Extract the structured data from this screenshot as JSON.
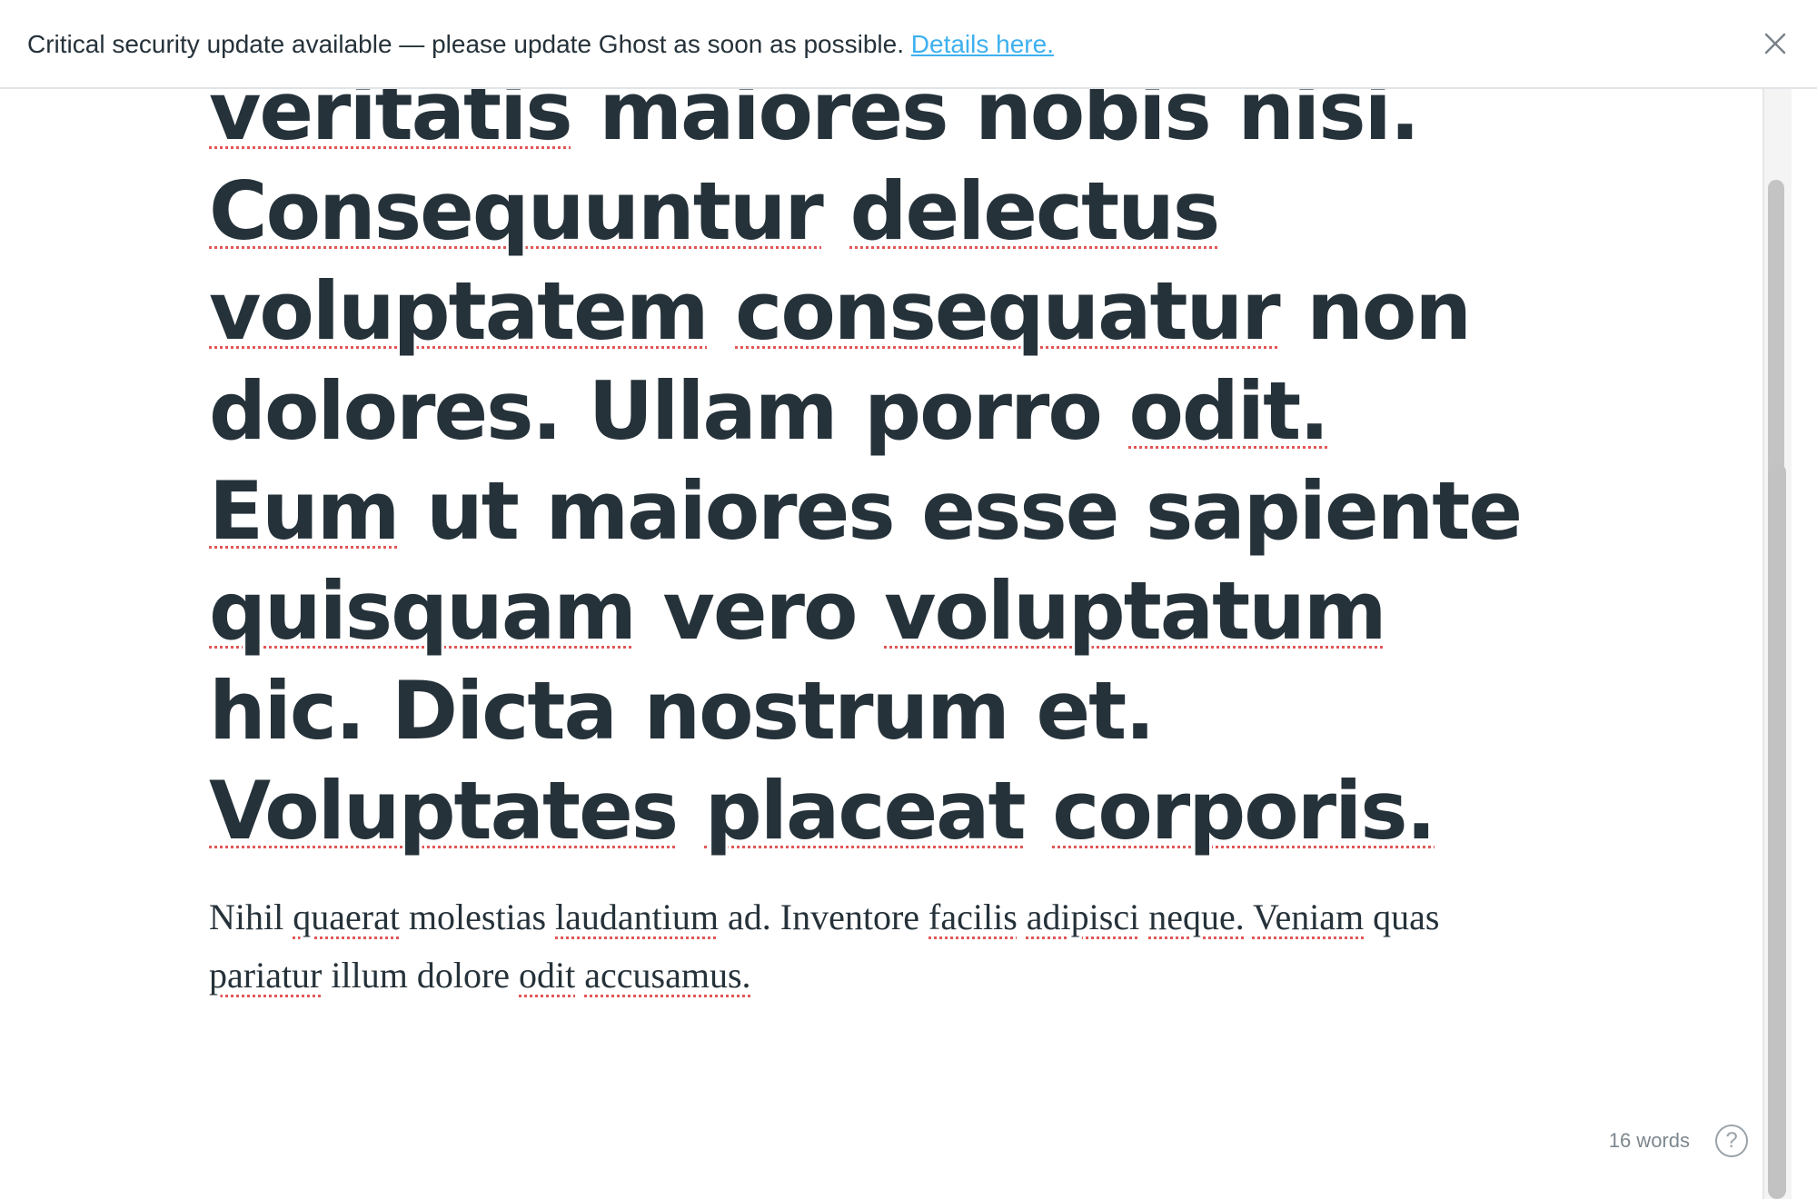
{
  "banner": {
    "message": "Critical security update available — please update Ghost as soon as possible.",
    "link_label": "Details here.",
    "close_icon": "close-icon",
    "link_color": "#3eb0ef"
  },
  "editor": {
    "title_words": [
      {
        "t": "veritatis",
        "sp": true
      },
      {
        "t": "maiores",
        "sp": false
      },
      {
        "t": "nobis",
        "sp": false
      },
      {
        "t": "nisi.",
        "sp": false
      },
      {
        "t": "Consequuntur",
        "sp": true
      },
      {
        "t": "delectus",
        "sp": true
      },
      {
        "t": "voluptatem",
        "sp": true
      },
      {
        "t": "consequatur",
        "sp": true
      },
      {
        "t": "non",
        "sp": false
      },
      {
        "t": "dolores.",
        "sp": false
      },
      {
        "t": "Ullam",
        "sp": false
      },
      {
        "t": "porro",
        "sp": false
      },
      {
        "t": "odit.",
        "sp": true
      },
      {
        "t": "Eum",
        "sp": true
      },
      {
        "t": "ut",
        "sp": false
      },
      {
        "t": "maiores",
        "sp": false
      },
      {
        "t": "esse",
        "sp": false
      },
      {
        "t": "sapiente",
        "sp": false
      },
      {
        "t": "quisquam",
        "sp": true
      },
      {
        "t": "vero",
        "sp": false
      },
      {
        "t": "voluptatum",
        "sp": true
      },
      {
        "t": "hic.",
        "sp": false
      },
      {
        "t": "Dicta",
        "sp": false
      },
      {
        "t": "nostrum",
        "sp": false
      },
      {
        "t": "et.",
        "sp": false
      },
      {
        "t": "Voluptates",
        "sp": true
      },
      {
        "t": "placeat",
        "sp": true
      },
      {
        "t": "corporis.",
        "sp": true
      }
    ],
    "body_words": [
      {
        "t": "Nihil",
        "sp": false
      },
      {
        "t": "quaerat",
        "sp": true
      },
      {
        "t": "molestias",
        "sp": false
      },
      {
        "t": "laudantium",
        "sp": true
      },
      {
        "t": "ad.",
        "sp": false
      },
      {
        "t": "Inventore",
        "sp": false
      },
      {
        "t": "facilis",
        "sp": true
      },
      {
        "t": "adipisci",
        "sp": true
      },
      {
        "t": "neque.",
        "sp": true
      },
      {
        "t": "Veniam",
        "sp": true
      },
      {
        "t": "quas",
        "sp": false
      },
      {
        "t": "pariatur",
        "sp": true
      },
      {
        "t": "illum",
        "sp": false
      },
      {
        "t": "dolore",
        "sp": false
      },
      {
        "t": "odit",
        "sp": true
      },
      {
        "t": "accusamus.",
        "sp": true
      }
    ],
    "spellcheck_color": "#e25656"
  },
  "status": {
    "word_count": "16 words",
    "help_label": "?",
    "help_icon": "help-circle-icon"
  }
}
